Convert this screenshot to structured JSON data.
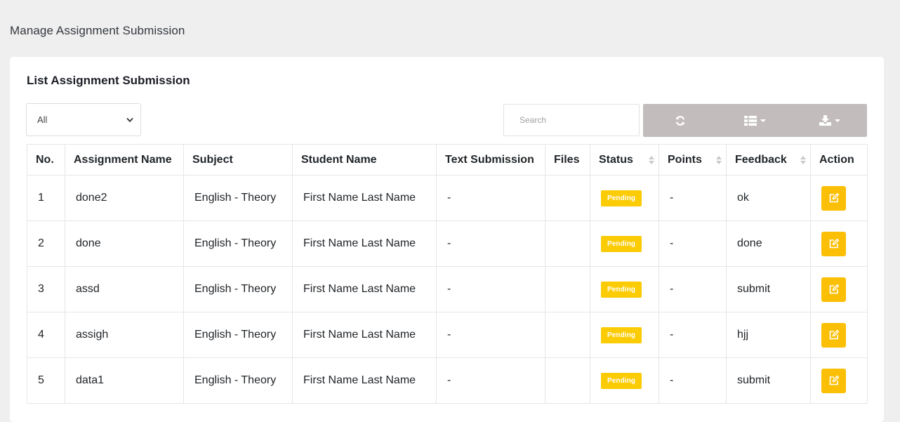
{
  "page": {
    "title": "Manage Assignment Submission"
  },
  "card": {
    "title": "List Assignment Submission"
  },
  "filter": {
    "selected": "All"
  },
  "search": {
    "placeholder": "Search"
  },
  "toolbar": {
    "refresh_icon": "refresh-icon",
    "columns_icon": "columns-list-icon",
    "export_icon": "download-icon"
  },
  "colors": {
    "toolbar": "#c2bdbc",
    "badge": "#fbcb04",
    "action": "#fbbf05",
    "background": "#efefef"
  },
  "table": {
    "headers": {
      "no": "No.",
      "assignment": "Assignment Name",
      "subject": "Subject",
      "student": "Student Name",
      "text": "Text Submission",
      "files": "Files",
      "status": "Status",
      "points": "Points",
      "feedback": "Feedback",
      "action": "Action"
    },
    "rows": [
      {
        "no": "1",
        "assignment": "done2",
        "subject": "English - Theory",
        "student": "First Name Last Name",
        "text": "-",
        "files": "",
        "status": "Pending",
        "points": "-",
        "feedback": "ok"
      },
      {
        "no": "2",
        "assignment": "done",
        "subject": "English - Theory",
        "student": "First Name Last Name",
        "text": "-",
        "files": "",
        "status": "Pending",
        "points": "-",
        "feedback": "done"
      },
      {
        "no": "3",
        "assignment": "assd",
        "subject": "English - Theory",
        "student": "First Name Last Name",
        "text": "-",
        "files": "",
        "status": "Pending",
        "points": "-",
        "feedback": "submit"
      },
      {
        "no": "4",
        "assignment": "assigh",
        "subject": "English - Theory",
        "student": "First Name Last Name",
        "text": "-",
        "files": "",
        "status": "Pending",
        "points": "-",
        "feedback": "hjj"
      },
      {
        "no": "5",
        "assignment": "data1",
        "subject": "English - Theory",
        "student": "First Name Last Name",
        "text": "-",
        "files": "",
        "status": "Pending",
        "points": "-",
        "feedback": "submit"
      }
    ]
  }
}
